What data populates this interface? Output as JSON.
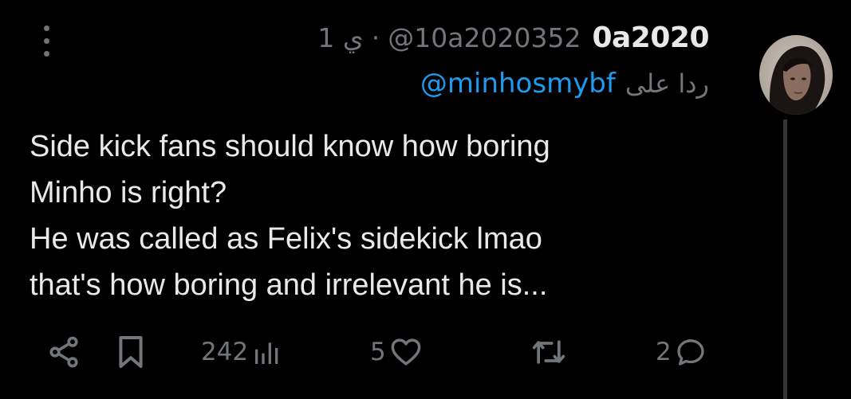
{
  "tweet": {
    "display_name": "0a2020",
    "handle": "@10a2020352",
    "separator": "·",
    "time": "1 ي",
    "reply_to_label": "ردا على",
    "reply_to_handle": "@minhosmybf",
    "text": "Side kick fans should know how boring\nMinho is right?\nHe was called as Felix's sidekick  lmao\nthat's how boring and irrelevant he is..."
  },
  "actions": {
    "views": "242",
    "likes": "5",
    "replies": "2"
  },
  "icons": [
    "more-vertical-icon",
    "share-icon",
    "bookmark-icon",
    "views-icon",
    "like-icon",
    "retweet-icon",
    "reply-icon"
  ],
  "colors": {
    "background": "#000000",
    "text": "#e7e9ea",
    "muted": "#71767b",
    "link": "#1d9bf0"
  }
}
